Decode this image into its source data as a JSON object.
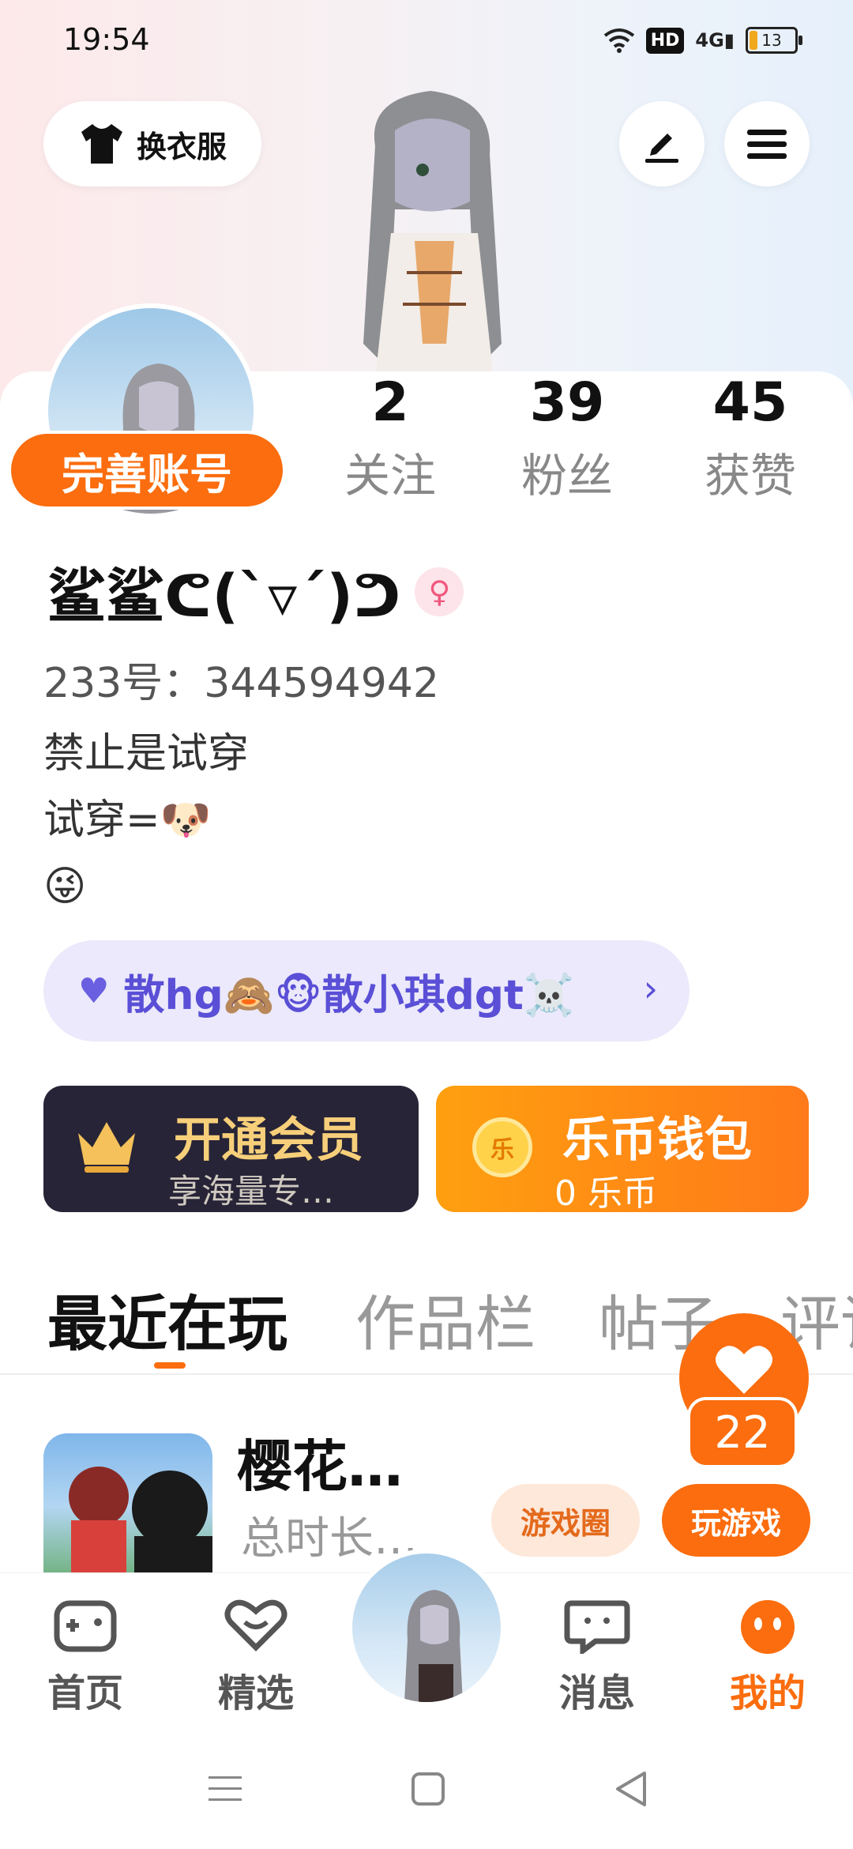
{
  "status_bar": {
    "time": "19:54",
    "hd": "HD",
    "signal": "4G",
    "battery": "13"
  },
  "header": {
    "dress_label": "换衣服"
  },
  "profile": {
    "complete_label": "完善账号",
    "stats": [
      {
        "num": "2",
        "label": "关注"
      },
      {
        "num": "39",
        "label": "粉丝"
      },
      {
        "num": "45",
        "label": "获赞"
      }
    ],
    "nickname": "鲨鲨ᕦ(ˋ▿ˊ)ᕤ",
    "gender_symbol": "♀",
    "uid": "233号：344594942",
    "bio": "禁止是试穿\n试穿=🐶\n😜",
    "fan_group": "散hg🙈🐵散小琪dgt☠️"
  },
  "cards": {
    "vip_title": "开通会员",
    "vip_sub": "享海量专…",
    "wallet_title": "乐币钱包",
    "wallet_sub": "0 乐币",
    "coin_symbol": "乐"
  },
  "tabs": [
    "最近在玩",
    "作品栏",
    "帖子",
    "评论"
  ],
  "like_count": "22",
  "game": {
    "title": "樱花…",
    "subtitle": "总时长…",
    "circle_btn": "游戏圈",
    "play_btn": "玩游戏"
  },
  "bottom_nav": [
    {
      "label": "首页"
    },
    {
      "label": "精选"
    },
    {
      "label": "消息"
    },
    {
      "label": "我的"
    }
  ],
  "colors": {
    "accent": "#fb6d0e",
    "vip_bg": "#272437",
    "fan_pill": "#ebe9fb"
  }
}
